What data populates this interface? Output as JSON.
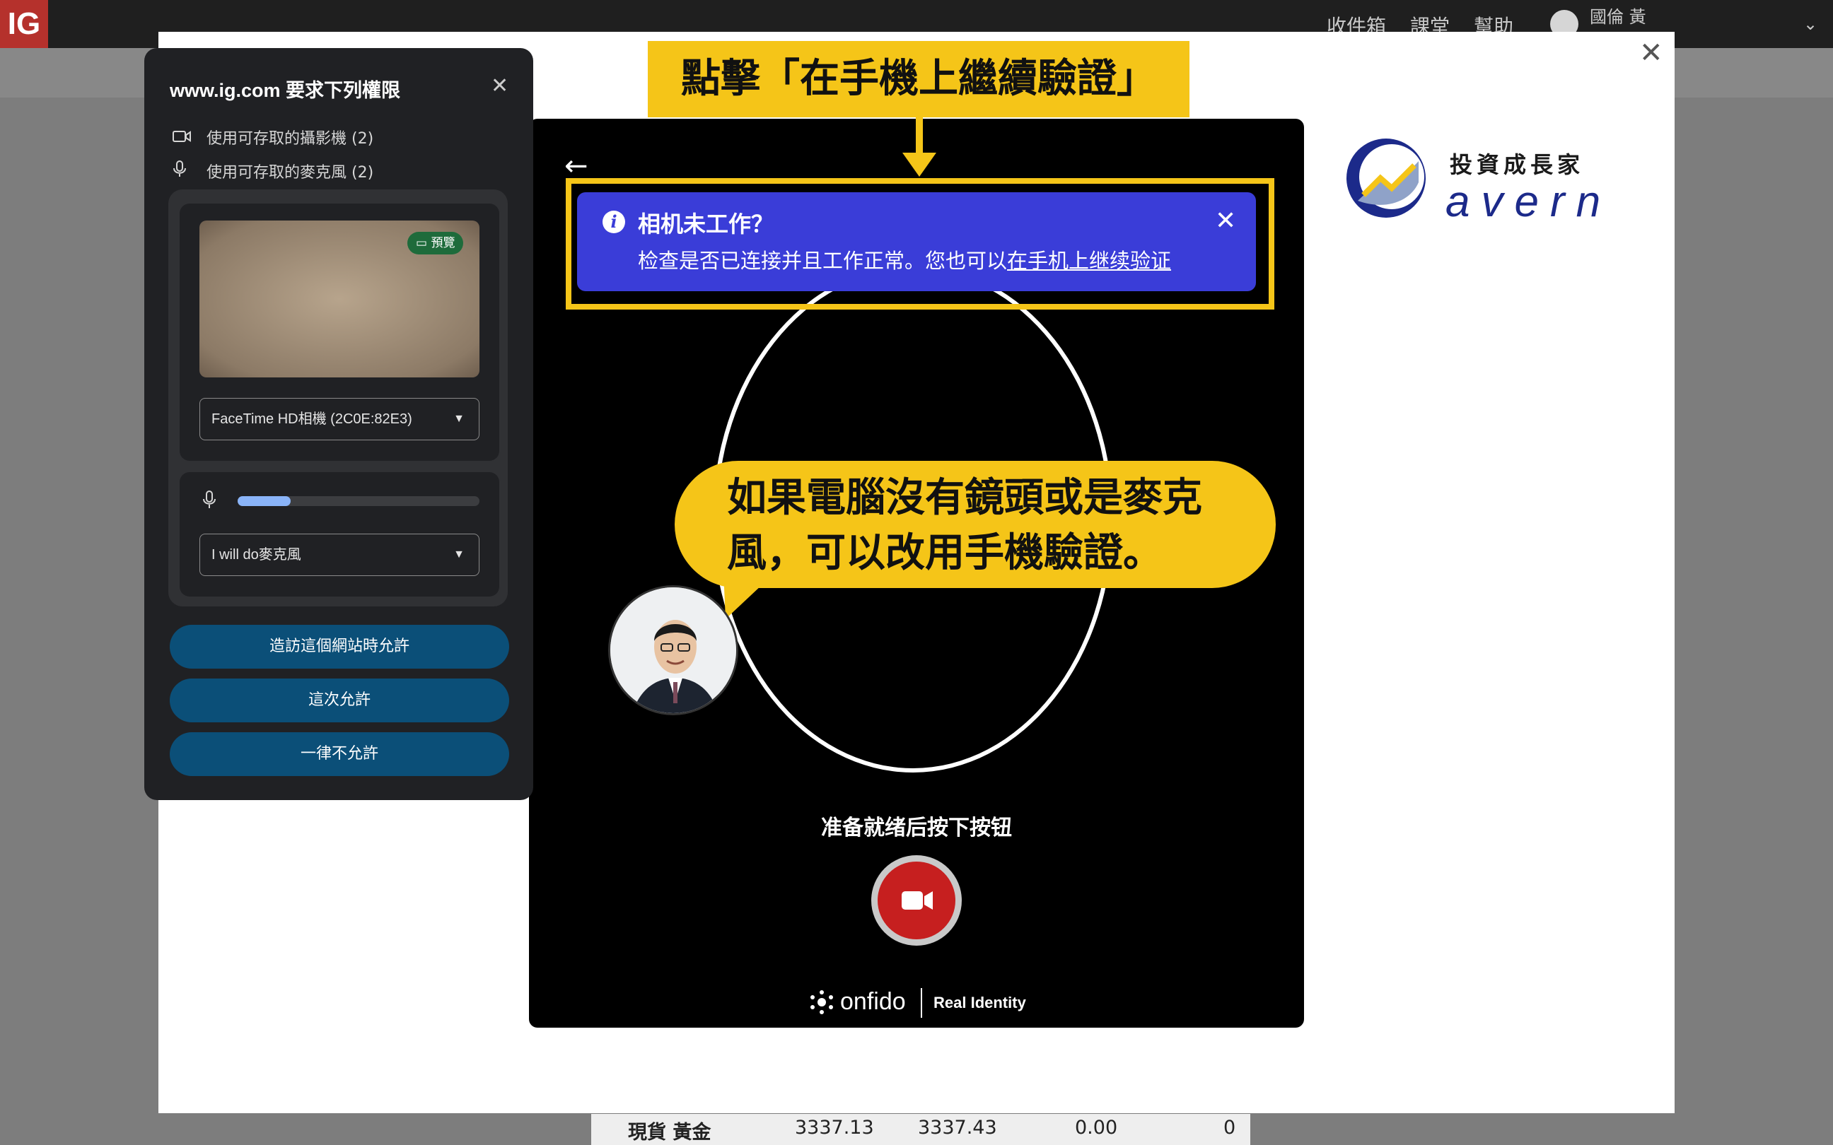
{
  "topbar": {
    "logo": "IG",
    "nav": [
      "收件箱",
      "課堂",
      "幫助"
    ],
    "user": "國倫 黃",
    "colors": {
      "bar": "#1f1f1f",
      "logo_bg": "#b5312c"
    }
  },
  "bottom_table_row": [
    "現貨 黃金",
    "3337.13",
    "3337.43",
    "0.00",
    "0"
  ],
  "permission_popup": {
    "title": "www.ig.com 要求下列權限",
    "rows": [
      {
        "icon": "video-camera-icon",
        "label": "使用可存取的攝影機 (2)"
      },
      {
        "icon": "microphone-icon",
        "label": "使用可存取的麥克風 (2)"
      }
    ],
    "preview_badge": "預覽",
    "camera_select": "FaceTime HD相機 (2C0E:82E3)",
    "mic_select": "I will do麥克風",
    "mic_level": 0.22,
    "buttons": [
      "造訪這個網站時允許",
      "這次允許",
      "一律不允許"
    ],
    "colors": {
      "bg": "#202124",
      "button": "#0b4f78"
    }
  },
  "onfido": {
    "info_title": "相机未工作？",
    "info_body": "检查是否已连接并且工作正常。您也可以",
    "info_link": "在手机上继续验证",
    "ready_text": "准备就绪后按下按钮",
    "footer_brand": "onfido",
    "footer_tagline": "Real Identity",
    "colors": {
      "info_bg": "#3a3dd8",
      "record": "#c61f1f"
    }
  },
  "annotation": {
    "top_label": "點擊「在手機上繼續驗證」",
    "bubble_text": "如果電腦沒有鏡頭或是麥克風，可以改用手機驗證。",
    "color": "#f5c518"
  },
  "brand": {
    "name": "投資成長家",
    "sub": "avern"
  }
}
